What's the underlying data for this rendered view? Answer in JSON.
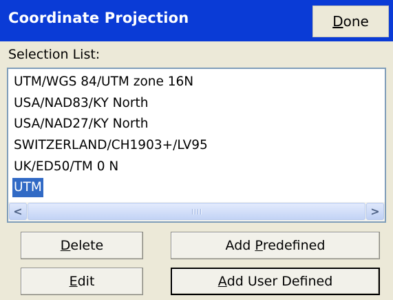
{
  "window": {
    "title": "Coordinate Projection",
    "done_button": {
      "accel": "D",
      "rest": "one"
    }
  },
  "selection": {
    "label": "Selection List:",
    "items": [
      "UTM/WGS 84/UTM zone 16N",
      "USA/NAD83/KY North",
      "USA/NAD27/KY North",
      "SWITZERLAND/CH1903+/LV95",
      "UK/ED50/TM 0 N",
      "UTM"
    ],
    "selected_index": 5
  },
  "scrollbar": {
    "left_arrow": "<",
    "right_arrow": ">"
  },
  "buttons": {
    "delete": {
      "accel": "D",
      "rest": "elete"
    },
    "add_predefined": {
      "pre": "Add ",
      "accel": "P",
      "rest": "redefined"
    },
    "edit": {
      "accel": "E",
      "rest": "dit"
    },
    "add_user_defined": {
      "accel": "A",
      "rest": "dd User Defined"
    }
  },
  "colors": {
    "titlebar": "#0a3bd6",
    "selection_highlight": "#316ac5",
    "window_bg": "#ece9d8"
  }
}
